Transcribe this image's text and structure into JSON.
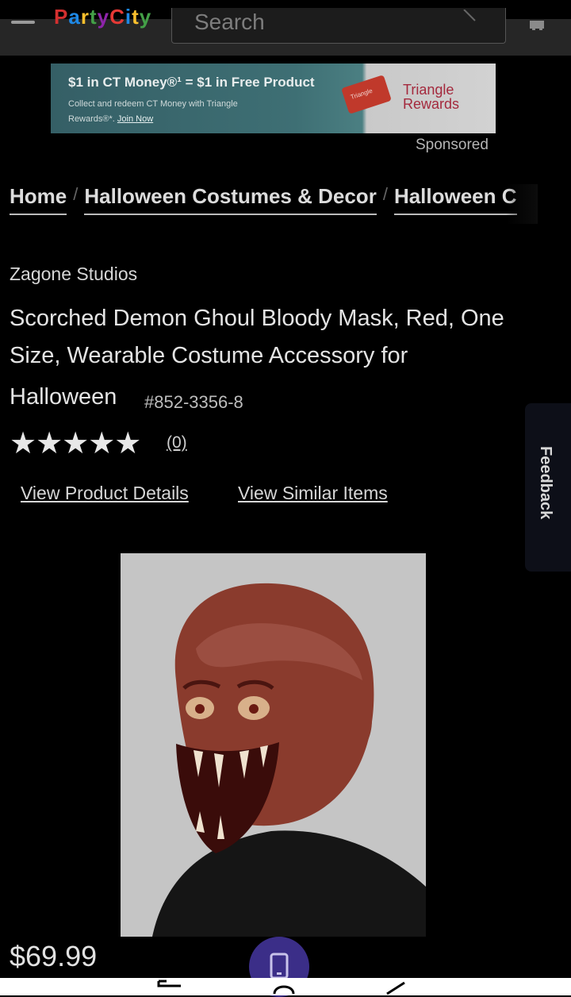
{
  "header": {
    "logo_text": "Party City",
    "search_placeholder": "Search"
  },
  "banner": {
    "title": "$1 in CT Money®¹ = $1 in Free Product",
    "subtitle": "Collect and redeem CT Money with Triangle Rewards®*.",
    "link": "Join Now",
    "card_text": "Triangle",
    "logo_line1": "Triangle",
    "logo_line2": "Rewards",
    "sponsored": "Sponsored"
  },
  "breadcrumb": [
    "Home",
    "Halloween Costumes & Decor",
    "Halloween C"
  ],
  "product": {
    "brand": "Zagone Studios",
    "title_line": "Scorched Demon Ghoul Bloody Mask, Red, One Size, Wearable Costume Accessory for",
    "title_end": "Halloween",
    "sku": "#852-3356-8",
    "stars": "★★★★★",
    "review_count": "(0)",
    "price": "$69.99"
  },
  "links": {
    "details": "View Product Details",
    "similar": "View Similar Items"
  },
  "feedback": "Feedback"
}
